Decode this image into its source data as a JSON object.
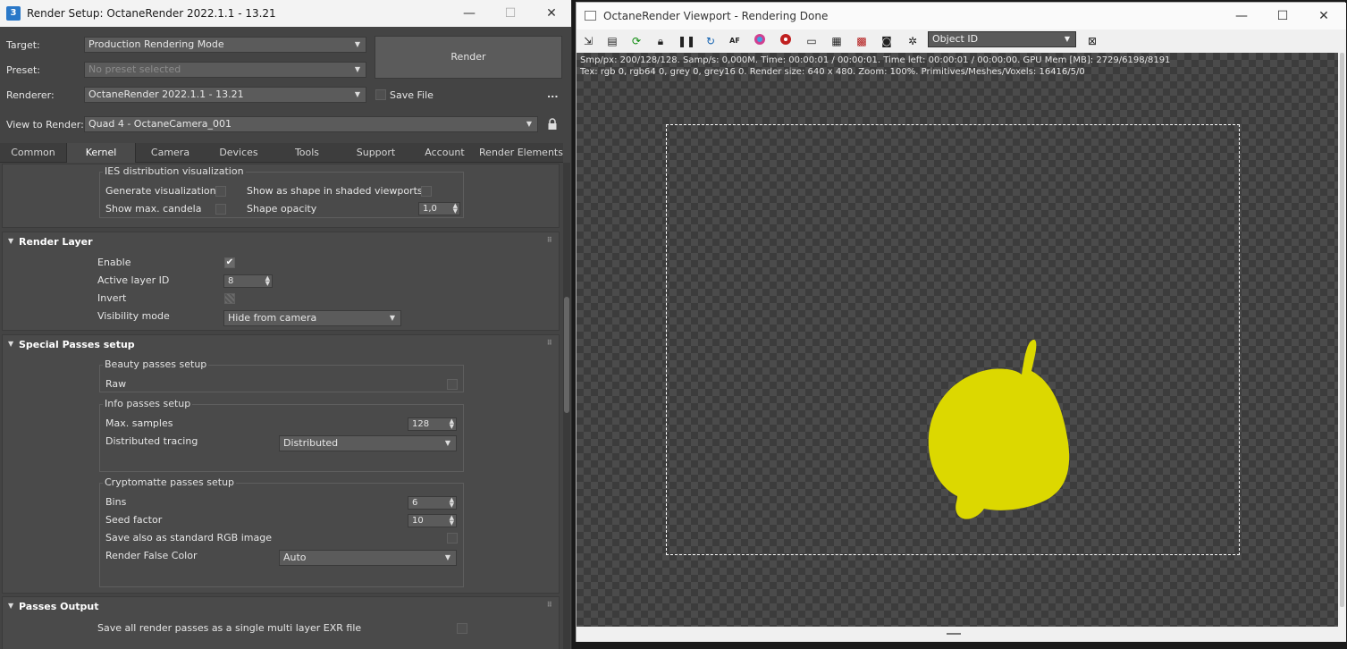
{
  "render_setup": {
    "title": "Render Setup: OctaneRender 2022.1.1 - 13.21",
    "app_icon": "3",
    "window_controls": {
      "minimize": "—",
      "maximize": "☐",
      "close": "✕"
    },
    "target_label": "Target:",
    "target_value": "Production Rendering Mode",
    "preset_label": "Preset:",
    "preset_value": "No preset selected",
    "renderer_label": "Renderer:",
    "renderer_value": "OctaneRender 2022.1.1 - 13.21",
    "save_file_label": "Save File",
    "more_label": "...",
    "view_label": "View to Render:",
    "view_value": "Quad 4 - OctaneCamera_001",
    "render_button": "Render",
    "tabs": [
      "Common",
      "Kernel",
      "Camera",
      "Devices",
      "Tools",
      "Support",
      "Account",
      "Render Elements"
    ],
    "active_tab": "Kernel",
    "ies": {
      "title": "IES distribution visualization",
      "generate": "Generate visualization",
      "show_shape": "Show as shape in shaded viewports",
      "show_candela": "Show max. candela",
      "shape_opacity": "Shape opacity",
      "shape_opacity_value": "1,0"
    },
    "render_layer": {
      "title": "Render Layer",
      "enable": "Enable",
      "enable_checked": true,
      "active_layer": "Active layer ID",
      "active_layer_value": "8",
      "invert": "Invert",
      "visibility": "Visibility mode",
      "visibility_value": "Hide from camera"
    },
    "special_passes": {
      "title": "Special Passes setup",
      "beauty_title": "Beauty passes setup",
      "raw": "Raw",
      "info_title": "Info passes setup",
      "max_samples": "Max. samples",
      "max_samples_value": "128",
      "dist_tracing": "Distributed tracing",
      "dist_tracing_value": "Distributed",
      "crypto_title": "Cryptomatte passes setup",
      "bins": "Bins",
      "bins_value": "6",
      "seed": "Seed factor",
      "seed_value": "10",
      "save_rgb": "Save also as standard RGB image",
      "false_color": "Render False Color",
      "false_color_value": "Auto"
    },
    "passes_output": {
      "title": "Passes Output",
      "save_all": "Save all render passes as a single multi layer EXR file"
    }
  },
  "viewport": {
    "title": "OctaneRender Viewport - Rendering Done",
    "window_controls": {
      "minimize": "—",
      "maximize": "☐",
      "close": "✕"
    },
    "pass_select": "Object ID",
    "info_line1": "Smp/px: 200/128/128.   Samp/s: 0,000M.   Time: 00:00:01 / 00:00:01.   Time left: 00:00:01 / 00:00:00.   GPU Mem [MB]: 2729/6198/8191",
    "info_line2": "Tex: rgb 0, rgb64 0, grey 0, grey16 0.   Render size: 640 x 480.   Zoom: 100%.   Primitives/Meshes/Voxels: 16416/5/0",
    "object_color": "#dcd800"
  }
}
